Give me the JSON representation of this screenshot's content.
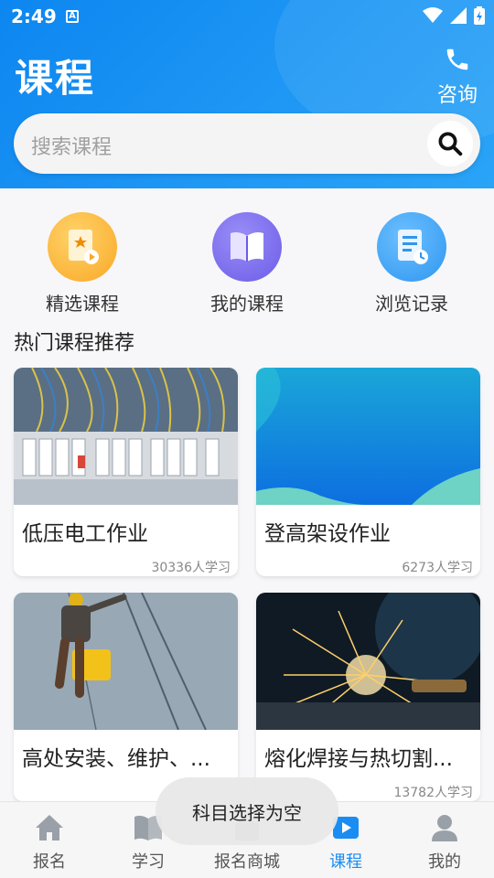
{
  "status": {
    "time": "2:49",
    "app_badge": "A"
  },
  "header": {
    "title": "课程",
    "consult_label": "咨询"
  },
  "search": {
    "placeholder": "搜索课程"
  },
  "quick_actions": [
    {
      "label": "精选课程",
      "icon": "featured-course-icon",
      "color": "#f9a825"
    },
    {
      "label": "我的课程",
      "icon": "book-icon",
      "color": "#7c6ff0"
    },
    {
      "label": "浏览记录",
      "icon": "history-icon",
      "color": "#2f96f0"
    }
  ],
  "section": {
    "title": "热门课程推荐"
  },
  "courses": [
    {
      "title": "低压电工作业",
      "count": "30336人学习",
      "image": "electrical-panel-photo"
    },
    {
      "title": "登高架设作业",
      "count": "6273人学习",
      "image": "blue-placeholder-graphic"
    },
    {
      "title": "高处安装、维护、...",
      "count": "",
      "image": "high-altitude-worker-photo"
    },
    {
      "title": "熔化焊接与热切割...",
      "count": "13782人学习",
      "image": "welding-sparks-photo"
    }
  ],
  "tabs": [
    {
      "label": "报名",
      "icon": "home-icon",
      "active": false
    },
    {
      "label": "学习",
      "icon": "study-icon",
      "active": false
    },
    {
      "label": "报名商城",
      "icon": "store-icon",
      "active": false
    },
    {
      "label": "课程",
      "icon": "course-play-icon",
      "active": true
    },
    {
      "label": "我的",
      "icon": "profile-icon",
      "active": false
    }
  ],
  "toast": {
    "message": "科目选择为空"
  },
  "colors": {
    "primary": "#1a8df2",
    "header_gradient_start": "#0d86f0"
  }
}
